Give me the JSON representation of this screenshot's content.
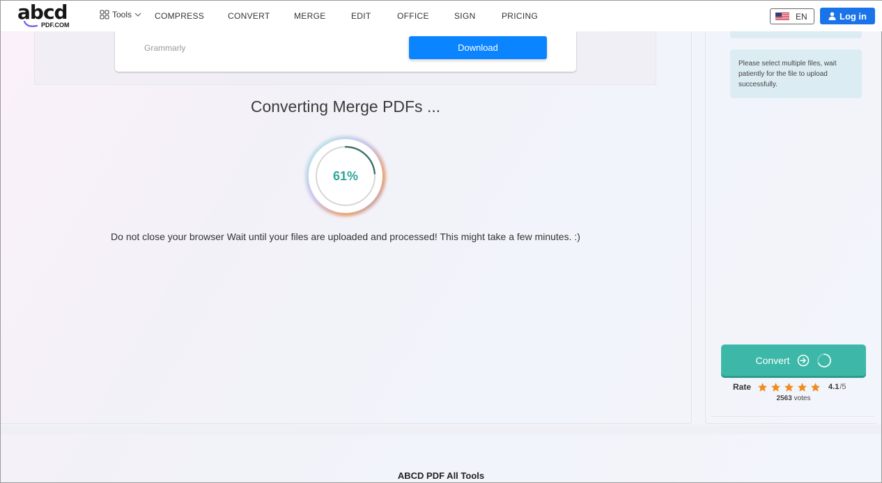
{
  "header": {
    "logo_word": "abcd",
    "logo_sub": "PDF.COM",
    "tools_label": "Tools",
    "nav": {
      "compress": "COMPRESS",
      "convert": "CONVERT",
      "merge": "MERGE",
      "edit": "EDIT",
      "office": "OFFICE",
      "sign": "SIGN",
      "pricing": "PRICING"
    },
    "language": "EN",
    "login_label": "Log in"
  },
  "ad": {
    "brand": "Grammarly",
    "download_label": "Download"
  },
  "main": {
    "converting_title": "Converting Merge PDFs ...",
    "progress_label": "61%",
    "progress_value": 0.61,
    "wait_message": "Do not close your browser Wait until your files are uploaded and processed! This might take a few minutes. :)"
  },
  "sidebar": {
    "info_message": "Please select multiple files, wait patiently for the file to upload successfully.",
    "convert_label": "Convert",
    "rate_label": "Rate",
    "stars": 5,
    "rating_score": "4.1",
    "rating_max": "/5",
    "votes_count": "2563",
    "votes_label": "votes"
  },
  "footer": {
    "title": "ABCD PDF All Tools"
  },
  "colors": {
    "accent_blue": "#1a73e8",
    "download_blue": "#0b84ff",
    "teal": "#3db8a8",
    "progress_text": "#2fa79a",
    "star": "#f28a1c",
    "info_bg": "#dcecf3"
  }
}
